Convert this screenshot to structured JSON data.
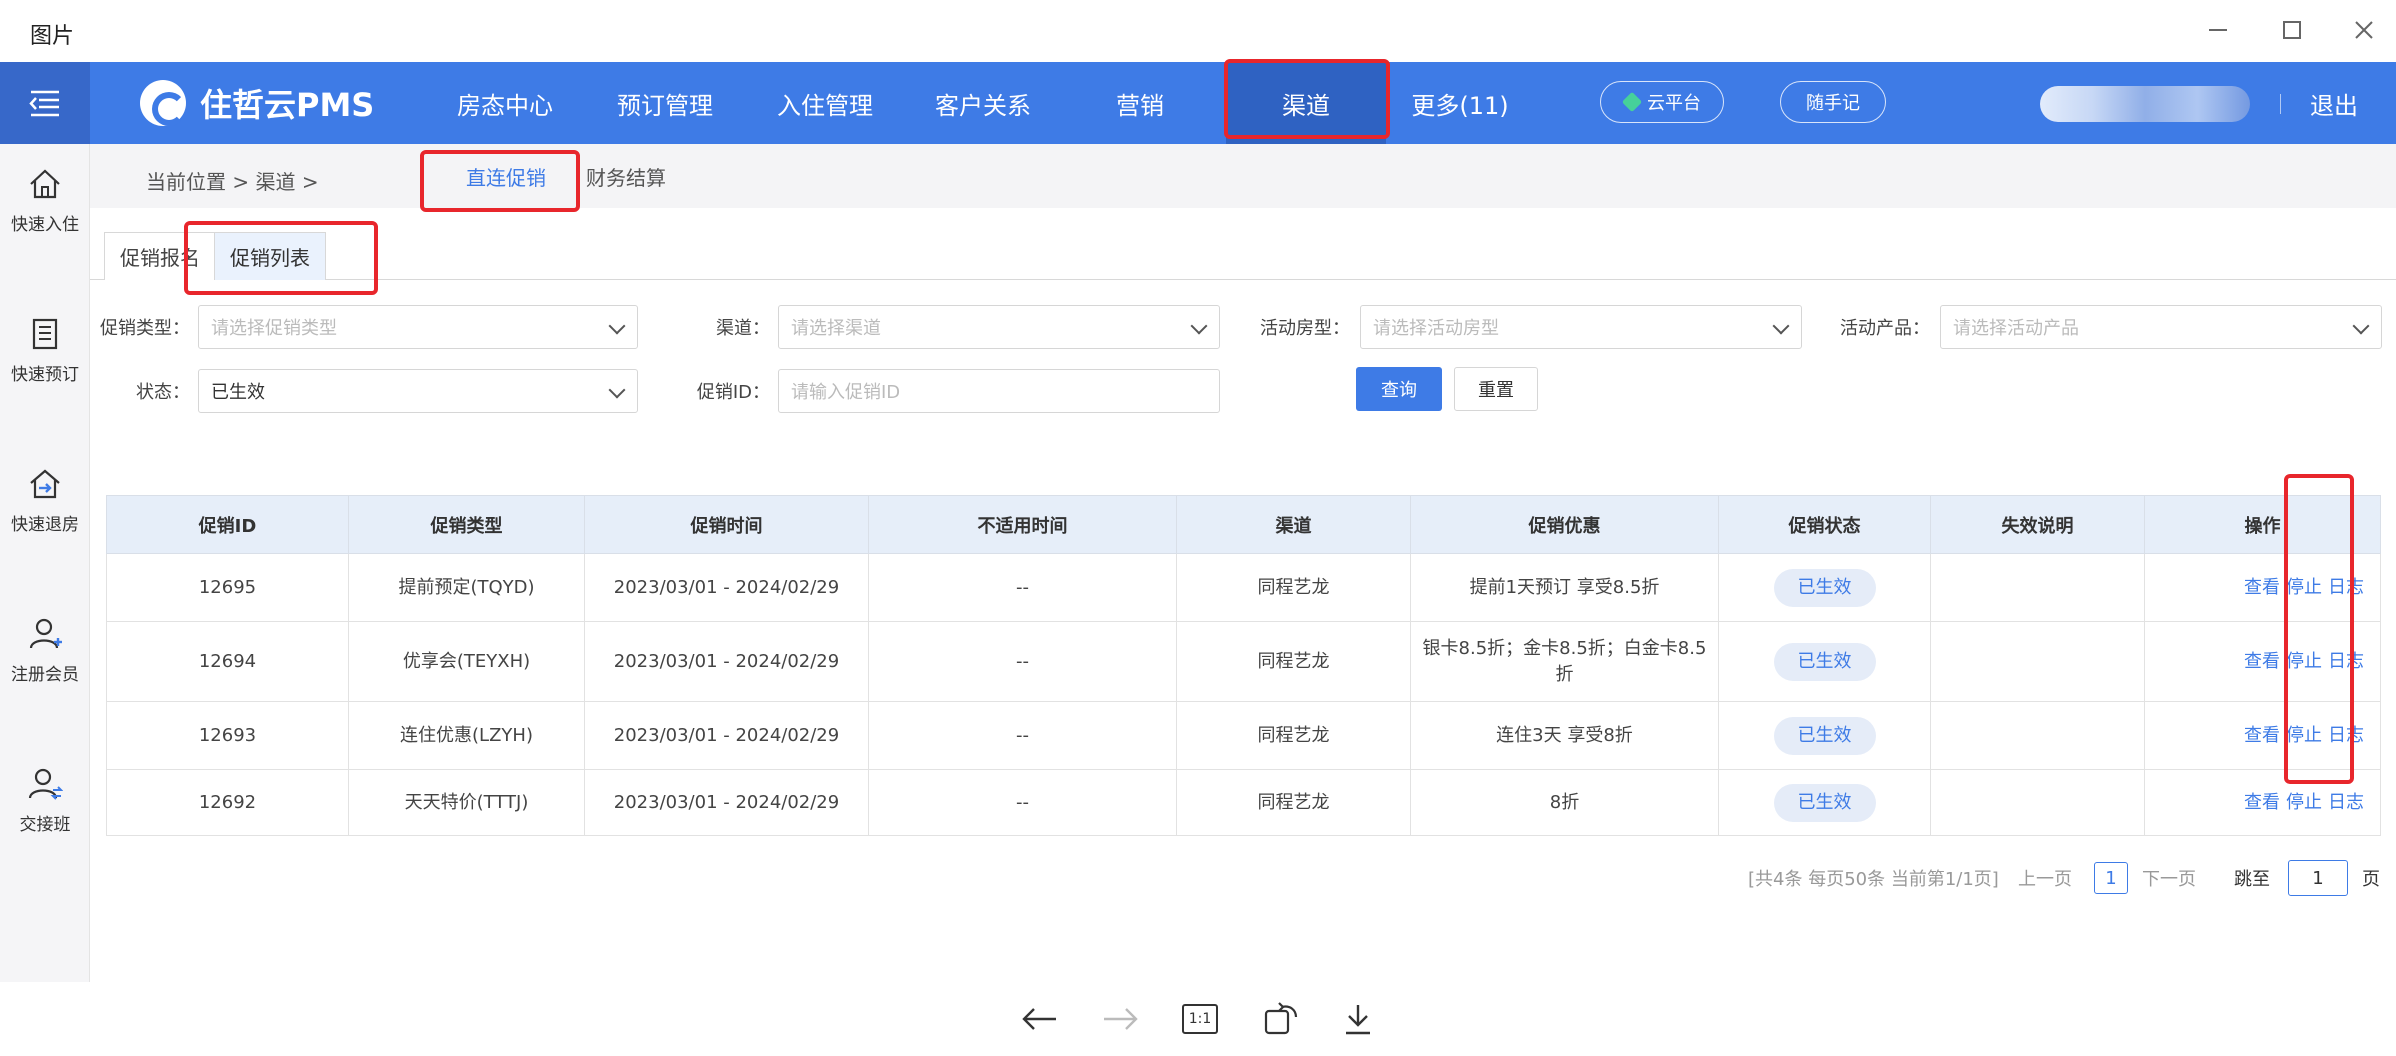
{
  "viewer": {
    "title": "图片",
    "toolbar": {
      "zoom_label": "1:1"
    }
  },
  "topnav": {
    "brand": "住哲云PMS",
    "items": [
      {
        "label": "房态中心"
      },
      {
        "label": "预订管理"
      },
      {
        "label": "入住管理"
      },
      {
        "label": "客户关系"
      },
      {
        "label": "营销"
      },
      {
        "label": "渠道",
        "active": true
      },
      {
        "label": "更多(11)"
      }
    ],
    "cloud_btn": "云平台",
    "note_btn": "随手记",
    "logout": "退出"
  },
  "sidebar": [
    {
      "label": "快速入住",
      "icon": "home-icon"
    },
    {
      "label": "快速预订",
      "icon": "book-icon"
    },
    {
      "label": "快速退房",
      "icon": "checkout-icon"
    },
    {
      "label": "注册会员",
      "icon": "add-member-icon"
    },
    {
      "label": "交接班",
      "icon": "handover-icon"
    }
  ],
  "breadcrumb": {
    "text": "当前位置  >  渠道  >"
  },
  "subtabs": [
    {
      "label": "直连促销",
      "active": true
    },
    {
      "label": "财务结算"
    }
  ],
  "tabs": [
    {
      "label": "促销报名"
    },
    {
      "label": "促销列表",
      "active": true
    }
  ],
  "filters": {
    "promo_type": {
      "label": "促销类型：",
      "placeholder": "请选择促销类型"
    },
    "channel": {
      "label": "渠道：",
      "placeholder": "请选择渠道"
    },
    "room_type": {
      "label": "活动房型：",
      "placeholder": "请选择活动房型"
    },
    "product": {
      "label": "活动产品：",
      "placeholder": "请选择活动产品"
    },
    "status": {
      "label": "状态：",
      "value": "已生效"
    },
    "promo_id": {
      "label": "促销ID：",
      "placeholder": "请输入促销ID"
    },
    "query_btn": "查询",
    "reset_btn": "重置"
  },
  "table": {
    "columns": [
      "促销ID",
      "促销类型",
      "促销时间",
      "不适用时间",
      "渠道",
      "促销优惠",
      "促销状态",
      "失效说明",
      "操作"
    ],
    "rows": [
      {
        "id": "12695",
        "type": "提前预定(TQYD)",
        "time": "2023/03/01 - 2024/02/29",
        "excluded": "--",
        "channel": "同程艺龙",
        "discount": "提前1天预订 享受8.5折",
        "status": "已生效",
        "reason": ""
      },
      {
        "id": "12694",
        "type": "优享会(TEYXH)",
        "time": "2023/03/01 - 2024/02/29",
        "excluded": "--",
        "channel": "同程艺龙",
        "discount": "银卡8.5折；金卡8.5折；白金卡8.5折",
        "status": "已生效",
        "reason": ""
      },
      {
        "id": "12693",
        "type": "连住优惠(LZYH)",
        "time": "2023/03/01 - 2024/02/29",
        "excluded": "--",
        "channel": "同程艺龙",
        "discount": "连住3天 享受8折",
        "status": "已生效",
        "reason": ""
      },
      {
        "id": "12692",
        "type": "天天特价(TTTJ)",
        "time": "2023/03/01 - 2024/02/29",
        "excluded": "--",
        "channel": "同程艺龙",
        "discount": "8折",
        "status": "已生效",
        "reason": ""
      }
    ],
    "actions": {
      "view": "查看",
      "stop": "停止",
      "log": "日志"
    }
  },
  "pager": {
    "summary": "[共4条 每页50条 当前第1/1页]",
    "prev": "上一页",
    "current": "1",
    "next": "下一页",
    "jump_label": "跳至",
    "jump_value": "1",
    "page_unit": "页"
  },
  "colors": {
    "brand": "#3e7be6",
    "highlight": "#e8262c"
  }
}
